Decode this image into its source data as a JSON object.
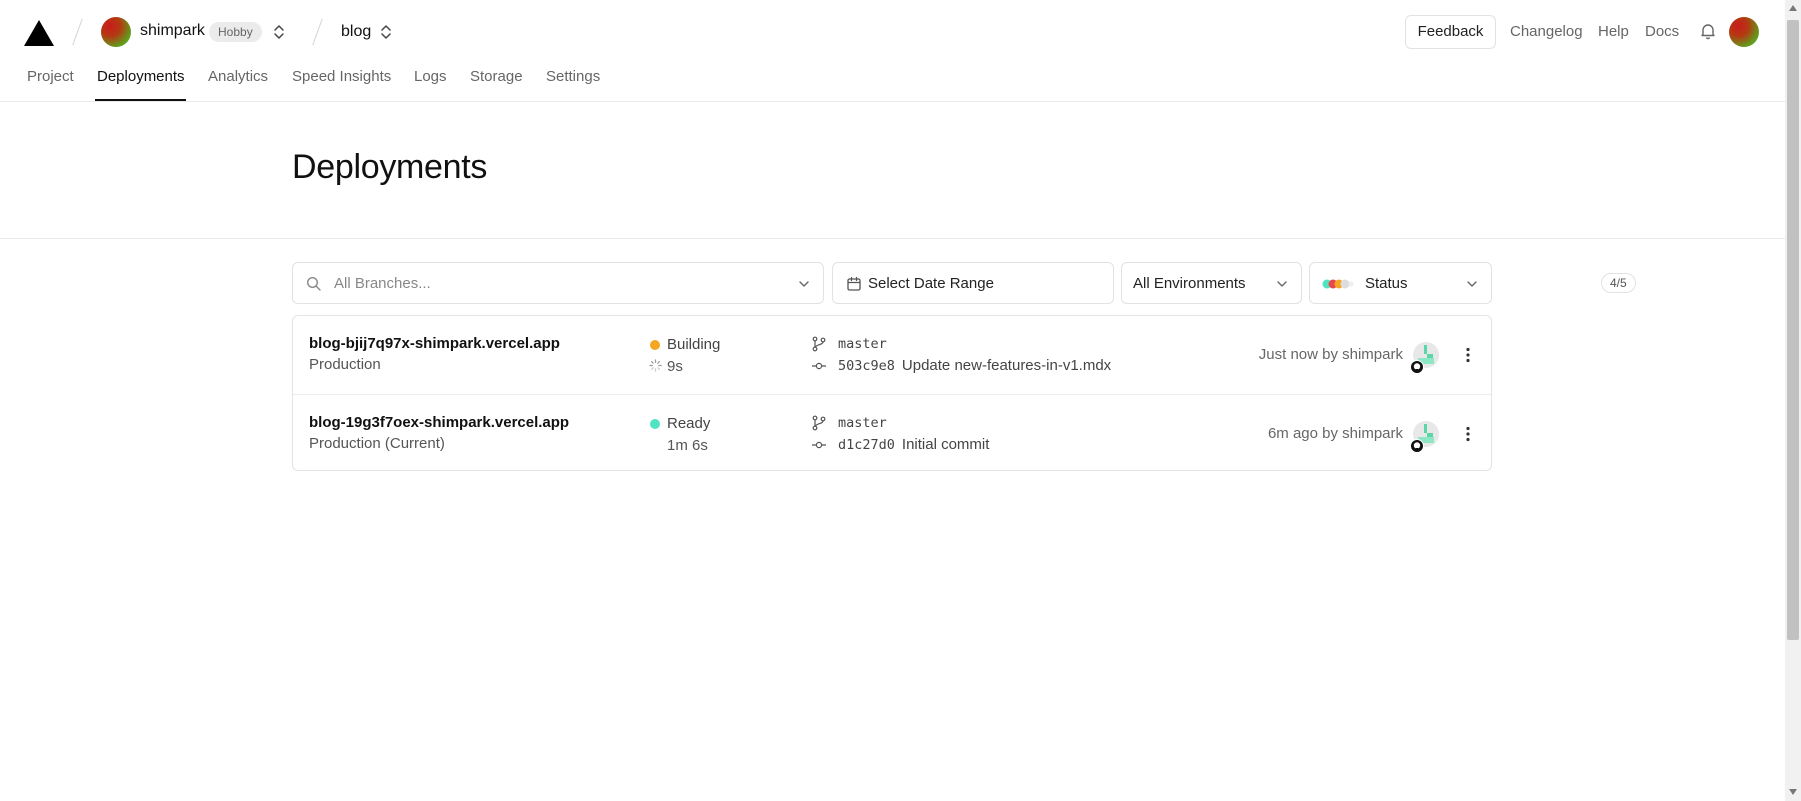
{
  "topbar": {
    "team_name": "shimpark",
    "plan_badge": "Hobby",
    "project_name": "blog",
    "feedback_label": "Feedback",
    "links": [
      "Changelog",
      "Help",
      "Docs"
    ]
  },
  "tabs": [
    {
      "label": "Project"
    },
    {
      "label": "Deployments"
    },
    {
      "label": "Analytics"
    },
    {
      "label": "Speed Insights"
    },
    {
      "label": "Logs"
    },
    {
      "label": "Storage"
    },
    {
      "label": "Settings"
    }
  ],
  "active_tab": "Deployments",
  "page_title": "Deployments",
  "filters": {
    "branches_placeholder": "All Branches...",
    "date_range_label": "Select Date Range",
    "environment_label": "All Environments",
    "status_label": "Status",
    "status_count": "4/5"
  },
  "deployments": [
    {
      "url": "blog-bjij7q97x-shimpark.vercel.app",
      "environment": "Production",
      "status": "Building",
      "status_color": "#f5a623",
      "duration": "9s",
      "branch": "master",
      "commit_hash": "503c9e8",
      "commit_message": "Update new-features-in-v1.mdx",
      "meta": "Just now by shimpark"
    },
    {
      "url": "blog-19g3f7oex-shimpark.vercel.app",
      "environment": "Production (Current)",
      "status": "Ready",
      "status_color": "#50e3c2",
      "duration": "1m 6s",
      "branch": "master",
      "commit_hash": "d1c27d0",
      "commit_message": "Initial commit",
      "meta": "6m ago by shimpark"
    }
  ],
  "icons": {
    "logo": "vercel-triangle-icon",
    "notifications": "bell-icon",
    "search": "search-icon",
    "calendar": "calendar-icon",
    "branch": "git-branch-icon",
    "commit": "git-commit-icon",
    "more": "kebab-menu-icon"
  }
}
